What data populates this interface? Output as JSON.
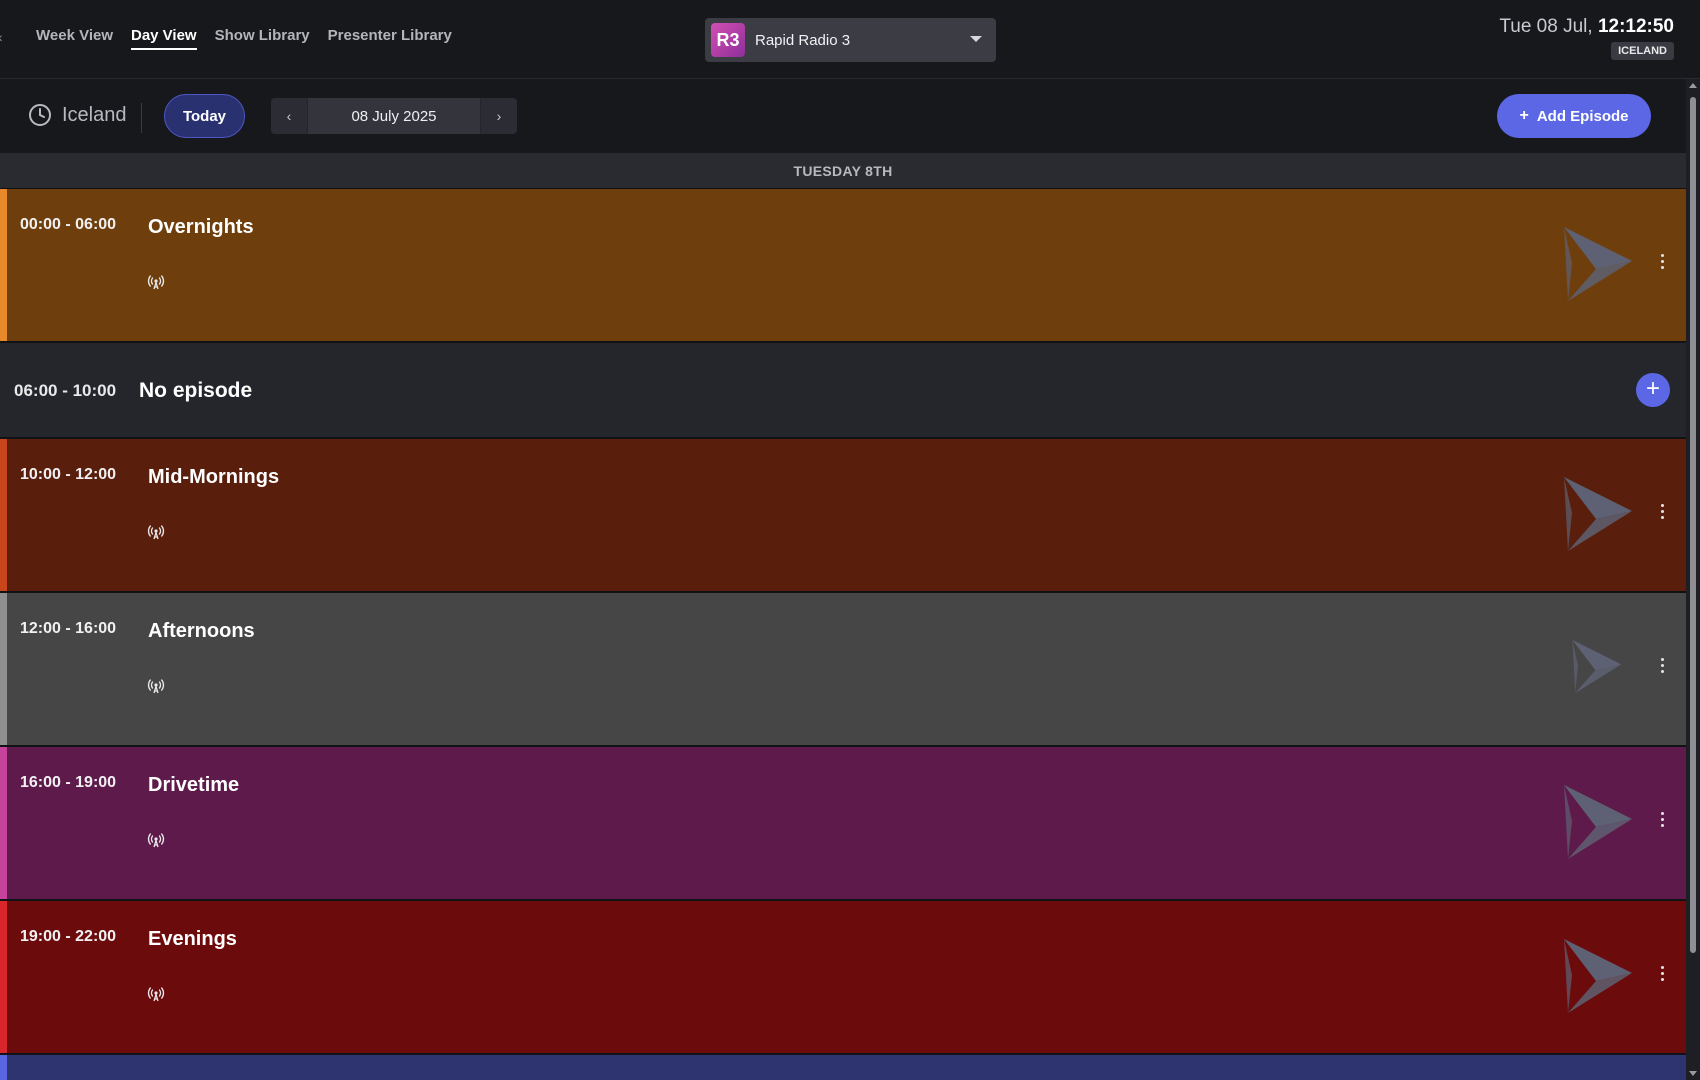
{
  "nav": {
    "items": [
      {
        "label": "Week View",
        "active": false
      },
      {
        "label": "Day View",
        "active": true
      },
      {
        "label": "Show Library",
        "active": false
      },
      {
        "label": "Presenter Library",
        "active": false
      }
    ]
  },
  "station": {
    "logo_text": "R3",
    "name": "Rapid Radio 3",
    "icon": "chevron-down-icon"
  },
  "clock": {
    "date": "Tue 08 Jul,",
    "time": "12:12:50",
    "timezone_badge": "ICELAND"
  },
  "toolbar": {
    "timezone_label": "Iceland",
    "today_label": "Today",
    "date": "08 July 2025",
    "add_episode_label": "Add Episode"
  },
  "day_header": "TUESDAY 8TH",
  "schedule": {
    "episodes": [
      {
        "time": "00:00 - 06:00",
        "title": "Overnights",
        "bg": "#6e3f0c",
        "accent": "#e7892a"
      },
      {
        "time": "10:00 - 12:00",
        "title": "Mid-Mornings",
        "bg": "#591e0c",
        "accent": "#c9461c"
      },
      {
        "time": "12:00 - 16:00",
        "title": "Afternoons",
        "bg": "#464646",
        "accent": "#8f8f8f"
      },
      {
        "time": "16:00 - 19:00",
        "title": "Drivetime",
        "bg": "#5e1a4a",
        "accent": "#c6439b"
      },
      {
        "time": "19:00 - 22:00",
        "title": "Evenings",
        "bg": "#6b0b0c",
        "accent": "#d8262a"
      }
    ],
    "empty_slot": {
      "time": "06:00 - 10:00",
      "title": "No episode"
    }
  }
}
